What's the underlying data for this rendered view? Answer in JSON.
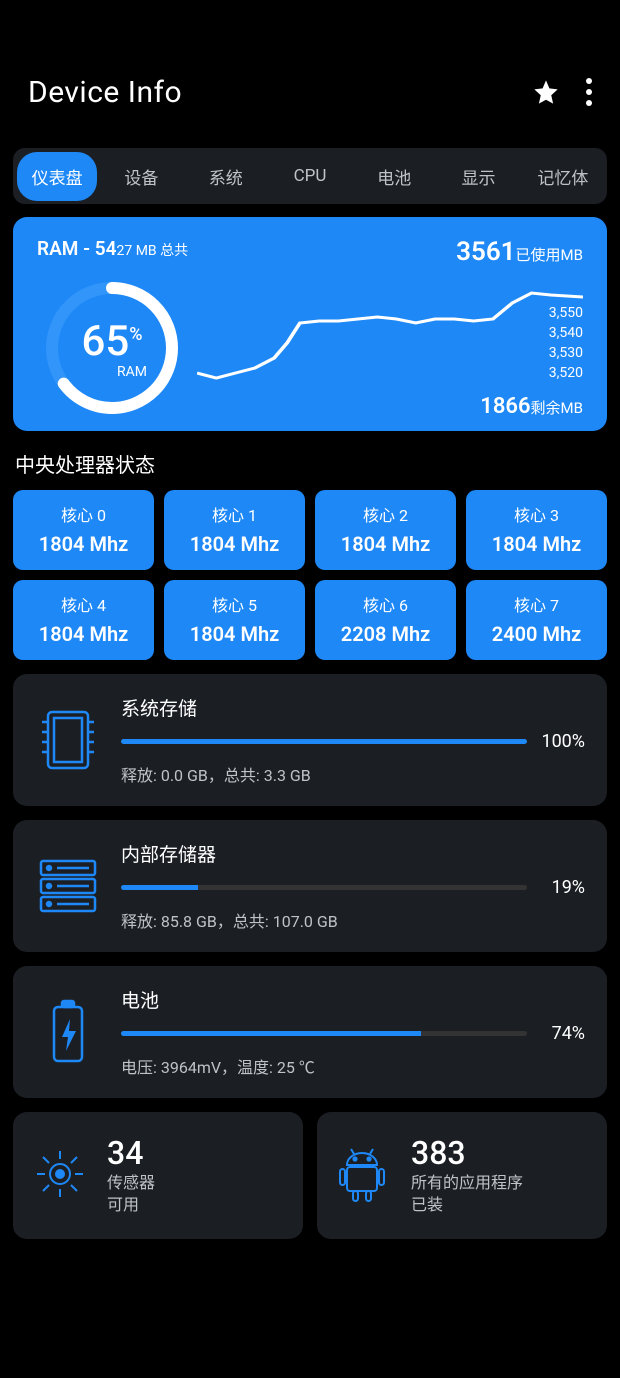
{
  "header": {
    "title": "Device Info"
  },
  "tabs": [
    {
      "label": "仪表盘",
      "active": true
    },
    {
      "label": "设备",
      "active": false
    },
    {
      "label": "系统",
      "active": false
    },
    {
      "label": "CPU",
      "active": false
    },
    {
      "label": "电池",
      "active": false
    },
    {
      "label": "显示",
      "active": false
    },
    {
      "label": "记忆体",
      "active": false
    }
  ],
  "ram_card": {
    "title_prefix": "RAM - 54",
    "title_small": "27 MB 总共",
    "used_value": "3561",
    "used_label": "已使用MB",
    "percent": "65",
    "percent_symbol": "%",
    "gauge_label": "RAM",
    "free_value": "1866",
    "free_label": "剩余MB",
    "y_ticks": [
      "3,550",
      "3,540",
      "3,530",
      "3,520"
    ]
  },
  "chart_data": {
    "type": "line",
    "title": "RAM usage (MB)",
    "xlabel": "",
    "ylabel": "MB",
    "ylim": [
      3515,
      3555
    ],
    "x": [
      0,
      1,
      2,
      3,
      4,
      5,
      6,
      7,
      8,
      9,
      10,
      11,
      12,
      13,
      14,
      15,
      16,
      17,
      18,
      19
    ],
    "values": [
      3520,
      3518,
      3521,
      3523,
      3528,
      3530,
      3539,
      3540,
      3540,
      3541,
      3542,
      3541,
      3539,
      3541,
      3541,
      3540,
      3541,
      3550,
      3554,
      3552
    ]
  },
  "cpu_section_title": "中央处理器状态",
  "cpu_cores": [
    {
      "name": "核心 0",
      "freq": "1804 Mhz"
    },
    {
      "name": "核心 1",
      "freq": "1804 Mhz"
    },
    {
      "name": "核心 2",
      "freq": "1804 Mhz"
    },
    {
      "name": "核心 3",
      "freq": "1804 Mhz"
    },
    {
      "name": "核心 4",
      "freq": "1804 Mhz"
    },
    {
      "name": "核心 5",
      "freq": "1804 Mhz"
    },
    {
      "name": "核心 6",
      "freq": "2208 Mhz"
    },
    {
      "name": "核心 7",
      "freq": "2400 Mhz"
    }
  ],
  "storage_cards": [
    {
      "title": "系统存储",
      "percent": 100,
      "percent_label": "100%",
      "sub": "释放: 0.0 GB，总共: 3.3 GB",
      "icon": "chip"
    },
    {
      "title": "内部存储器",
      "percent": 19,
      "percent_label": "19%",
      "sub": "释放: 85.8 GB，总共: 107.0 GB",
      "icon": "server"
    },
    {
      "title": "电池",
      "percent": 74,
      "percent_label": "74%",
      "sub": "电压: 3964mV，温度: 25 ℃",
      "icon": "battery"
    }
  ],
  "bottom_stats": [
    {
      "value": "34",
      "line1": "传感器",
      "line2": "可用",
      "icon": "sensor"
    },
    {
      "value": "383",
      "line1": "所有的应用程序",
      "line2": "已装",
      "icon": "android"
    }
  ]
}
